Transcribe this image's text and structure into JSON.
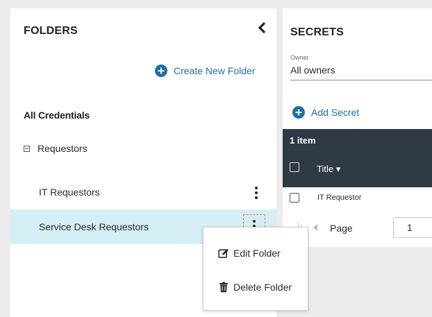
{
  "folders": {
    "title": "FOLDERS",
    "create_label": "Create New Folder",
    "all_credentials": "All Credentials",
    "group": {
      "label": "Requestors"
    },
    "items": [
      {
        "label": "IT Requestors"
      },
      {
        "label": "Service Desk Requestors",
        "selected": true
      }
    ]
  },
  "context_menu": {
    "edit_label": "Edit Folder",
    "delete_label": "Delete Folder"
  },
  "secrets": {
    "title": "SECRETS",
    "owner_label": "Owner",
    "owner_value": "All owners",
    "add_label": "Add Secret",
    "count": "1 item",
    "column_title": "Title ▾",
    "rows": [
      {
        "title": "IT Requestor"
      }
    ],
    "pager": {
      "label": "Page",
      "page": "1"
    }
  },
  "colors": {
    "accent": "#1d6fa5",
    "selected_row": "#d5edf5",
    "table_header": "#2f3a44",
    "focus_outline": "#d9822b"
  },
  "icons": {
    "collapse": "chevron-left-icon",
    "create": "plus-circle-icon",
    "group_toggle": "collapse-minus-icon",
    "row_menu": "kebab-menu-icon",
    "edit": "edit-icon",
    "delete": "trash-icon"
  }
}
